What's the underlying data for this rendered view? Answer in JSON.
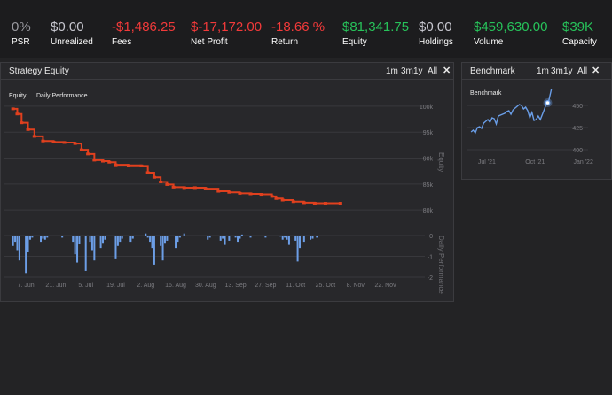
{
  "stats": [
    {
      "value": "0%",
      "label": "PSR",
      "color": "#9a9aa0"
    },
    {
      "value": "$0.00",
      "label": "Unrealized",
      "color": "#c8c8d0"
    },
    {
      "value": "-$1,486.25",
      "label": "Fees",
      "color": "#f23a3a"
    },
    {
      "value": "$-17,172.00",
      "label": "Net Profit",
      "color": "#f23a3a"
    },
    {
      "value": "-18.66 %",
      "label": "Return",
      "color": "#f23a3a"
    },
    {
      "value": "$81,341.75",
      "label": "Equity",
      "color": "#27c25a"
    },
    {
      "value": "$0.00",
      "label": "Holdings",
      "color": "#c8c8d0"
    },
    {
      "value": "$459,630.00",
      "label": "Volume",
      "color": "#27c25a"
    },
    {
      "value": "$39K",
      "label": "Capacity",
      "color": "#27c25a"
    }
  ],
  "strategy_panel": {
    "title": "Strategy Equity",
    "ranges": [
      "1m",
      "3m",
      "1y",
      "All"
    ],
    "legend": [
      "Equity",
      "Daily Performance"
    ]
  },
  "benchmark_panel": {
    "title": "Benchmark",
    "ranges": [
      "1m",
      "3m",
      "1y",
      "All"
    ],
    "legend": [
      "Benchmark"
    ]
  },
  "colors": {
    "equity": "#e0401e",
    "equity_outline": "#b8432c",
    "daily_performance": "#6c9ee6",
    "benchmark": "#6a9ee8",
    "grid": "#38383c",
    "axis_text": "#7d7d82"
  },
  "icons": {
    "close": "close-icon"
  },
  "chart_data": [
    {
      "type": "line",
      "title": "Strategy Equity",
      "series": [
        {
          "name": "Equity",
          "x": [
            "2021-06-01",
            "2021-06-03",
            "2021-06-05",
            "2021-06-08",
            "2021-06-11",
            "2021-06-15",
            "2021-06-20",
            "2021-06-25",
            "2021-06-30",
            "2021-07-03",
            "2021-07-06",
            "2021-07-09",
            "2021-07-13",
            "2021-07-16",
            "2021-07-19",
            "2021-07-25",
            "2021-07-31",
            "2021-08-03",
            "2021-08-06",
            "2021-08-09",
            "2021-08-12",
            "2021-08-15",
            "2021-08-20",
            "2021-08-25",
            "2021-08-30",
            "2021-09-05",
            "2021-09-10",
            "2021-09-15",
            "2021-09-20",
            "2021-09-25",
            "2021-09-30",
            "2021-10-02",
            "2021-10-05",
            "2021-10-10",
            "2021-10-15",
            "2021-10-20",
            "2021-10-25",
            "2021-11-01"
          ],
          "values": [
            99.5,
            98.5,
            96.8,
            95.5,
            94.2,
            93.3,
            93.1,
            93.0,
            92.8,
            91.6,
            90.8,
            89.6,
            89.4,
            89.2,
            88.7,
            88.6,
            88.5,
            87.2,
            86.3,
            85.4,
            84.9,
            84.4,
            84.3,
            84.3,
            84.1,
            83.6,
            83.4,
            83.2,
            83.1,
            83.0,
            82.6,
            82.2,
            81.9,
            81.6,
            81.4,
            81.3,
            81.3,
            81.3
          ]
        },
        {
          "name": "Daily Performance",
          "x": [
            "2021-06-01",
            "2021-06-02",
            "2021-06-03",
            "2021-06-04",
            "2021-06-07",
            "2021-06-08",
            "2021-06-09",
            "2021-06-10",
            "2021-06-14",
            "2021-06-15",
            "2021-06-16",
            "2021-06-17",
            "2021-06-24",
            "2021-06-29",
            "2021-06-30",
            "2021-07-01",
            "2021-07-02",
            "2021-07-05",
            "2021-07-07",
            "2021-07-08",
            "2021-07-09",
            "2021-07-12",
            "2021-07-13",
            "2021-07-14",
            "2021-07-19",
            "2021-07-20",
            "2021-07-21",
            "2021-07-22",
            "2021-07-26",
            "2021-07-27",
            "2021-08-02",
            "2021-08-03",
            "2021-08-04",
            "2021-08-05",
            "2021-08-06",
            "2021-08-09",
            "2021-08-10",
            "2021-08-11",
            "2021-08-12",
            "2021-08-16",
            "2021-08-17",
            "2021-08-18",
            "2021-08-20",
            "2021-08-31",
            "2021-09-01",
            "2021-09-06",
            "2021-09-07",
            "2021-09-08",
            "2021-09-10",
            "2021-09-13",
            "2021-09-14",
            "2021-09-15",
            "2021-09-16",
            "2021-09-20",
            "2021-09-27",
            "2021-10-04",
            "2021-10-05",
            "2021-10-06",
            "2021-10-07",
            "2021-10-08",
            "2021-10-11",
            "2021-10-12",
            "2021-10-13",
            "2021-10-15",
            "2021-10-18",
            "2021-10-19",
            "2021-10-21"
          ],
          "values": [
            -0.5,
            -0.3,
            -0.7,
            -1.2,
            -1.8,
            -0.8,
            -0.2,
            -0.1,
            -0.3,
            -0.15,
            -0.2,
            -0.1,
            -0.1,
            -0.3,
            -0.9,
            -1.3,
            -0.4,
            -1.7,
            -0.3,
            -0.7,
            -1.2,
            -0.6,
            -0.35,
            -0.2,
            -1.1,
            -0.5,
            -0.3,
            -0.15,
            -0.3,
            -0.15,
            0.1,
            -0.1,
            -0.3,
            -0.6,
            -1.4,
            -0.5,
            -1.2,
            -0.35,
            -0.25,
            -0.6,
            -0.3,
            -0.1,
            0.1,
            -0.2,
            -0.1,
            -0.25,
            -0.15,
            -0.45,
            -0.25,
            -0.1,
            -0.3,
            -0.15,
            0.05,
            -0.1,
            -0.1,
            -0.05,
            -0.2,
            -0.1,
            -0.2,
            -0.45,
            -0.25,
            -1.25,
            -0.6,
            -0.3,
            -0.2,
            -0.15,
            -0.1
          ]
        }
      ],
      "xlabel": "",
      "ylabel": "Equity",
      "ylabel2": "Daily Performance",
      "x_ticks": [
        "7. Jun",
        "21. Jun",
        "5. Jul",
        "19. Jul",
        "2. Aug",
        "16. Aug",
        "30. Aug",
        "13. Sep",
        "27. Sep",
        "11. Oct",
        "25. Oct",
        "8. Nov",
        "22. Nov"
      ],
      "y_ticks": [
        "100k",
        "95k",
        "90k",
        "85k",
        "80k"
      ],
      "y2_ticks": [
        "0",
        "-1",
        "-2"
      ],
      "ylim": [
        79,
        100.5
      ],
      "ylim2": [
        -2,
        0.3
      ],
      "legend_position": "top-left",
      "grid": true
    },
    {
      "type": "line",
      "title": "Benchmark",
      "series": [
        {
          "name": "Benchmark",
          "x": [
            "2021-06-01",
            "2021-06-05",
            "2021-06-09",
            "2021-06-13",
            "2021-06-17",
            "2021-06-21",
            "2021-06-25",
            "2021-06-29",
            "2021-07-03",
            "2021-07-07",
            "2021-07-11",
            "2021-07-15",
            "2021-07-19",
            "2021-07-23",
            "2021-07-27",
            "2021-07-31",
            "2021-08-04",
            "2021-08-08",
            "2021-08-12",
            "2021-08-16",
            "2021-08-20",
            "2021-08-24",
            "2021-08-28",
            "2021-09-01",
            "2021-09-05",
            "2021-09-09",
            "2021-09-13",
            "2021-09-17",
            "2021-09-21",
            "2021-09-25",
            "2021-09-29",
            "2021-10-03",
            "2021-10-07",
            "2021-10-11",
            "2021-10-15",
            "2021-10-19",
            "2021-10-23",
            "2021-10-27",
            "2021-11-01"
          ],
          "values": [
            420,
            422,
            419,
            425,
            426,
            424,
            430,
            432,
            434,
            431,
            436,
            435,
            429,
            438,
            439,
            440,
            441,
            443,
            444,
            440,
            445,
            447,
            449,
            451,
            450,
            446,
            448,
            444,
            436,
            442,
            433,
            434,
            438,
            434,
            440,
            446,
            453,
            455,
            468
          ]
        }
      ],
      "xlabel": "",
      "ylabel": "",
      "x_ticks": [
        "Jul '21",
        "Oct '21",
        "Jan '22"
      ],
      "y_ticks": [
        "450",
        "425",
        "400"
      ],
      "ylim": [
        398,
        472
      ],
      "highlighted_point": {
        "x": "2021-10-25",
        "value": 453
      },
      "legend_position": "top-left",
      "grid": true
    }
  ]
}
